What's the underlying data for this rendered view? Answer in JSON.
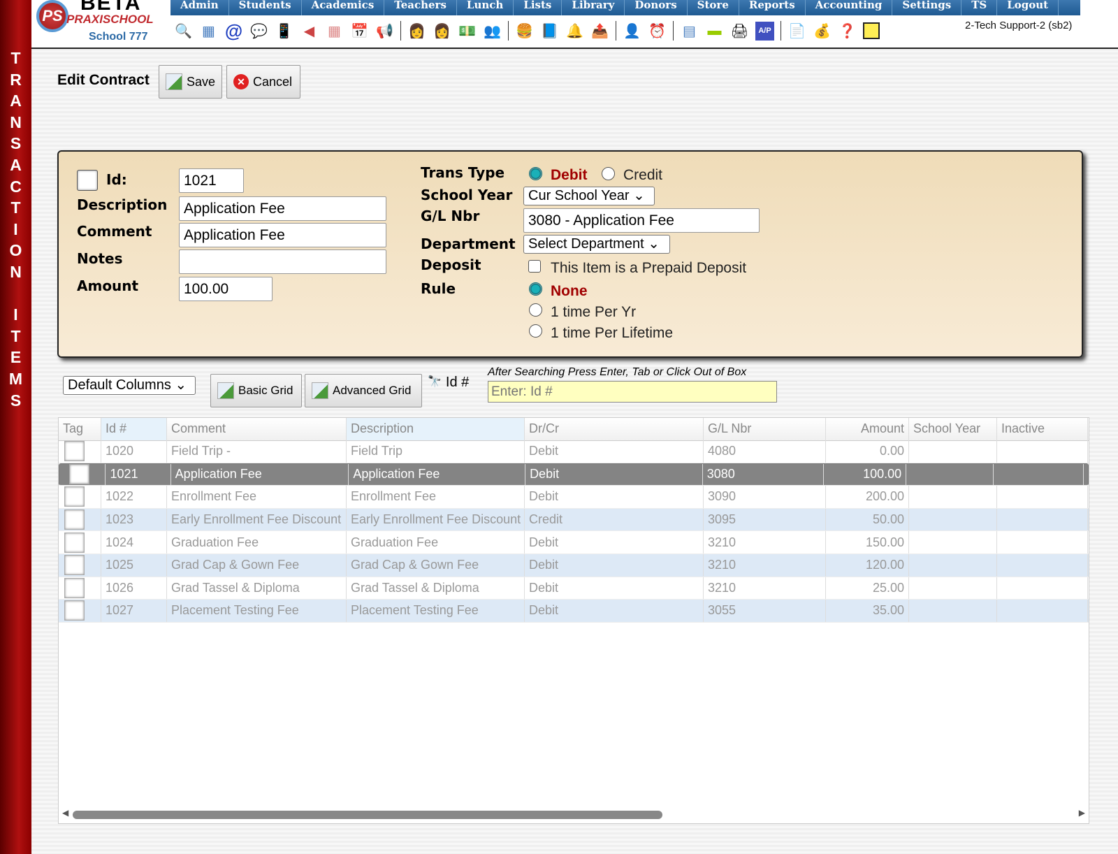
{
  "sidebar": {
    "letters": [
      "T",
      "R",
      "A",
      "N",
      "S",
      "A",
      "C",
      "T",
      "I",
      "O",
      "N",
      "",
      "I",
      "T",
      "E",
      "M",
      "S"
    ]
  },
  "logo": {
    "beta": "BETA",
    "brand": "PRAXISCHOOL",
    "school": "School 777",
    "mark": "PS"
  },
  "nav": [
    "Admin",
    "Students",
    "Academics",
    "Teachers",
    "Lunch",
    "Lists",
    "Library",
    "Donors",
    "Store",
    "Reports",
    "Accounting",
    "Settings",
    "TS",
    "Logout"
  ],
  "user": "2-Tech Support-2 (sb2)",
  "page": {
    "title": "Edit Contract",
    "save": "Save",
    "cancel": "Cancel"
  },
  "form": {
    "id_label": "Id:",
    "id": "1021",
    "description_label": "Description",
    "description": "Application Fee",
    "comment_label": "Comment",
    "comment": "Application Fee",
    "notes_label": "Notes",
    "notes": "",
    "amount_label": "Amount",
    "amount": "100.00",
    "trans_type_label": "Trans Type",
    "debit": "Debit",
    "credit": "Credit",
    "school_year_label": "School Year",
    "school_year": "Cur School Year",
    "gl_label": "G/L Nbr",
    "gl": "3080 - Application Fee",
    "department_label": "Department",
    "department": "Select Department",
    "deposit_label": "Deposit",
    "deposit_text": "This Item is a Prepaid Deposit",
    "rule_label": "Rule",
    "rules": [
      "None",
      "1 time Per Yr",
      "1 time Per Lifetime"
    ]
  },
  "toolbar": {
    "columns": "Default Columns",
    "basic": "Basic Grid",
    "advanced": "Advanced Grid",
    "search_label": "Id #",
    "hint": "After Searching Press Enter, Tab or Click Out of Box",
    "placeholder": "Enter: Id #"
  },
  "grid": {
    "headers": [
      "Tag",
      "Id #",
      "Comment",
      "Description",
      "Dr/Cr",
      "G/L Nbr",
      "Amount",
      "School Year",
      "Inactive"
    ],
    "rows": [
      [
        "1020",
        "Field Trip -",
        "Field Trip",
        "Debit",
        "4080",
        "0.00"
      ],
      [
        "1021",
        "Application Fee",
        "Application Fee",
        "Debit",
        "3080",
        "100.00"
      ],
      [
        "1022",
        "Enrollment Fee",
        "Enrollment Fee",
        "Debit",
        "3090",
        "200.00"
      ],
      [
        "1023",
        "Early Enrollment Fee Discount",
        "Early Enrollment Fee Discount",
        "Credit",
        "3095",
        "50.00"
      ],
      [
        "1024",
        "Graduation Fee",
        "Graduation Fee",
        "Debit",
        "3210",
        "150.00"
      ],
      [
        "1025",
        "Grad Cap & Gown Fee",
        "Grad Cap & Gown Fee",
        "Debit",
        "3210",
        "120.00"
      ],
      [
        "1026",
        "Grad Tassel & Diploma",
        "Grad Tassel & Diploma",
        "Debit",
        "3210",
        "25.00"
      ],
      [
        "1027",
        "Placement Testing Fee",
        "Placement Testing Fee",
        "Debit",
        "3055",
        "35.00"
      ]
    ]
  }
}
